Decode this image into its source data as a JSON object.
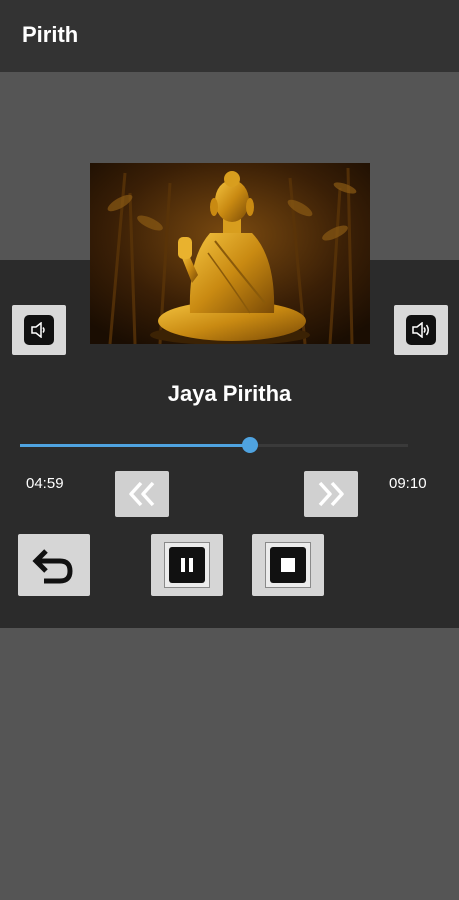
{
  "app_bar": {
    "title": "Pirith"
  },
  "player": {
    "track_title": "Jaya Piritha",
    "elapsed": "04:59",
    "duration": "09:10",
    "progress_fraction": 0.594
  },
  "icons": {
    "volume_down": "volume-down-icon",
    "volume_up": "volume-up-icon",
    "rewind": "rewind-icon",
    "fast_forward": "fast-forward-icon",
    "back": "undo-arrow-icon",
    "pause": "pause-icon",
    "stop": "stop-icon"
  },
  "colors": {
    "app_bar": "#333333",
    "panel": "#2b2b2b",
    "background": "#555555",
    "accent": "#4fa3e0"
  }
}
